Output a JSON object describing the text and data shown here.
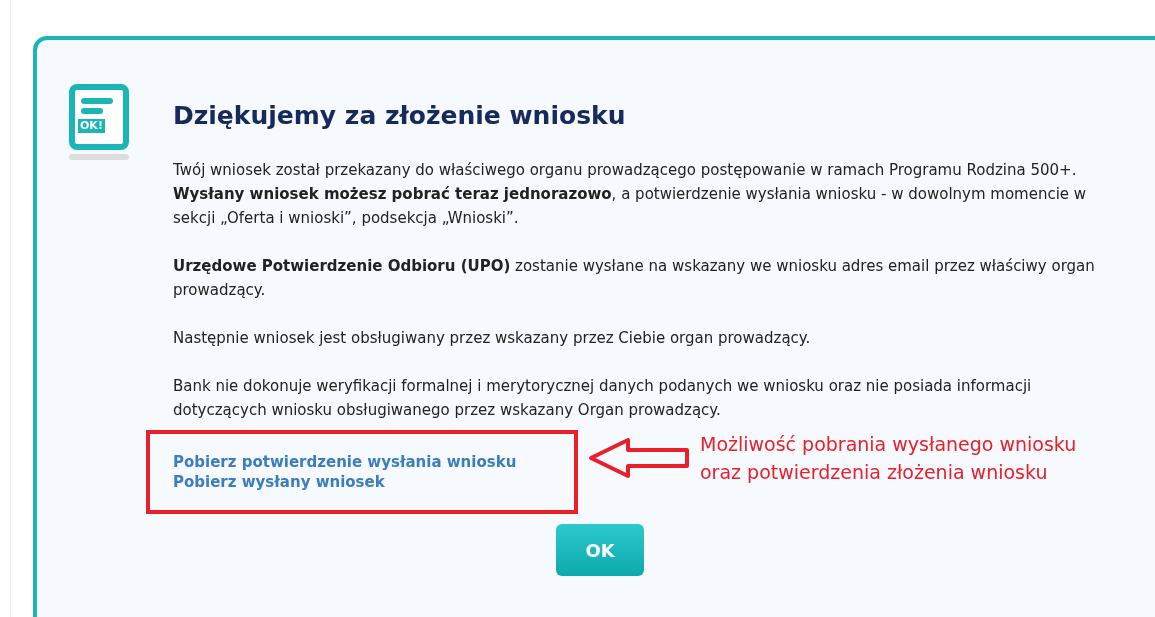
{
  "dialog": {
    "icon_label": "OK!",
    "title": "Dziękujemy za złożenie wniosku",
    "paragraphs": [
      "Twój wniosek został przekazany do właściwego organu prowadzącego postępowanie w ramach Programu Rodzina 500+. **Wysłany wniosek możesz pobrać teraz jednorazowo**, a potwierdzenie wysłania wniosku - w dowolnym momencie w sekcji „Oferta i wnioski”, podsekcja „Wnioski”.",
      "**Urzędowe Potwierdzenie Odbioru (UPO)** zostanie wysłane na wskazany we wniosku adres email przez właściwy organ prowadzący.",
      "Następnie wniosek jest obsługiwany przez wskazany przez Ciebie organ prowadzący.",
      "Bank nie dokonuje weryfikacji formalnej i merytorycznej danych podanych we wniosku oraz nie posiada informacji dotyczących wniosku obsługiwanego przez wskazany Organ prowadzący."
    ],
    "links": [
      "Pobierz potwierdzenie wysłania wniosku",
      "Pobierz wysłany wniosek"
    ],
    "ok_button": "OK"
  },
  "annotation": [
    "Możliwość pobrania wysłanego wniosku",
    "oraz potwierdzenia złożenia wniosku"
  ]
}
